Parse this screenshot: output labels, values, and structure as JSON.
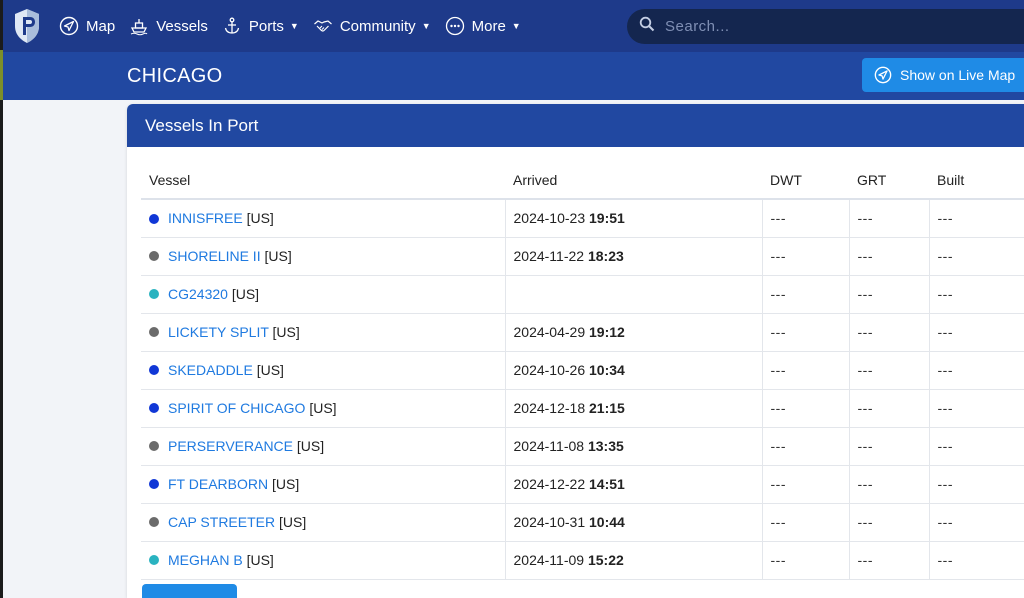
{
  "nav": {
    "items": [
      {
        "label": "Map",
        "icon": "compass-arrow-icon",
        "dropdown": false
      },
      {
        "label": "Vessels",
        "icon": "ship-icon",
        "dropdown": false
      },
      {
        "label": "Ports",
        "icon": "anchor-icon",
        "dropdown": true
      },
      {
        "label": "Community",
        "icon": "handshake-icon",
        "dropdown": true
      },
      {
        "label": "More",
        "icon": "dots-circle-icon",
        "dropdown": true
      }
    ],
    "search_placeholder": "Search..."
  },
  "header": {
    "port_name": "CHICAGO",
    "live_map_label": "Show on Live Map"
  },
  "card": {
    "title": "Vessels In Port",
    "columns": [
      "Vessel",
      "Arrived",
      "DWT",
      "GRT",
      "Built"
    ],
    "rows": [
      {
        "status_color": "#1037d6",
        "name": "INNISFREE",
        "flag": "[US]",
        "date": "2024-10-23",
        "time": "19:51",
        "dwt": "---",
        "grt": "---",
        "built": "---"
      },
      {
        "status_color": "#6b6b6b",
        "name": "SHORELINE II",
        "flag": "[US]",
        "date": "2024-11-22",
        "time": "18:23",
        "dwt": "---",
        "grt": "---",
        "built": "---"
      },
      {
        "status_color": "#2ab3c0",
        "name": "CG24320",
        "flag": "[US]",
        "date": "",
        "time": "",
        "dwt": "---",
        "grt": "---",
        "built": "---"
      },
      {
        "status_color": "#6b6b6b",
        "name": "LICKETY SPLIT",
        "flag": "[US]",
        "date": "2024-04-29",
        "time": "19:12",
        "dwt": "---",
        "grt": "---",
        "built": "---"
      },
      {
        "status_color": "#1037d6",
        "name": "SKEDADDLE",
        "flag": "[US]",
        "date": "2024-10-26",
        "time": "10:34",
        "dwt": "---",
        "grt": "---",
        "built": "---"
      },
      {
        "status_color": "#1037d6",
        "name": "SPIRIT OF CHICAGO",
        "flag": "[US]",
        "date": "2024-12-18",
        "time": "21:15",
        "dwt": "---",
        "grt": "---",
        "built": "---"
      },
      {
        "status_color": "#6b6b6b",
        "name": "PERSERVERANCE",
        "flag": "[US]",
        "date": "2024-11-08",
        "time": "13:35",
        "dwt": "---",
        "grt": "---",
        "built": "---"
      },
      {
        "status_color": "#1037d6",
        "name": "FT DEARBORN",
        "flag": "[US]",
        "date": "2024-12-22",
        "time": "14:51",
        "dwt": "---",
        "grt": "---",
        "built": "---"
      },
      {
        "status_color": "#6b6b6b",
        "name": "CAP STREETER",
        "flag": "[US]",
        "date": "2024-10-31",
        "time": "10:44",
        "dwt": "---",
        "grt": "---",
        "built": "---"
      },
      {
        "status_color": "#2ab3c0",
        "name": "MEGHAN B",
        "flag": "[US]",
        "date": "2024-11-09",
        "time": "15:22",
        "dwt": "---",
        "grt": "---",
        "built": "---"
      }
    ]
  },
  "colors": {
    "nav_bg": "#1e3a8a",
    "subheader_bg": "#2148a1",
    "accent": "#1f8be6",
    "link": "#1f7ae0"
  }
}
